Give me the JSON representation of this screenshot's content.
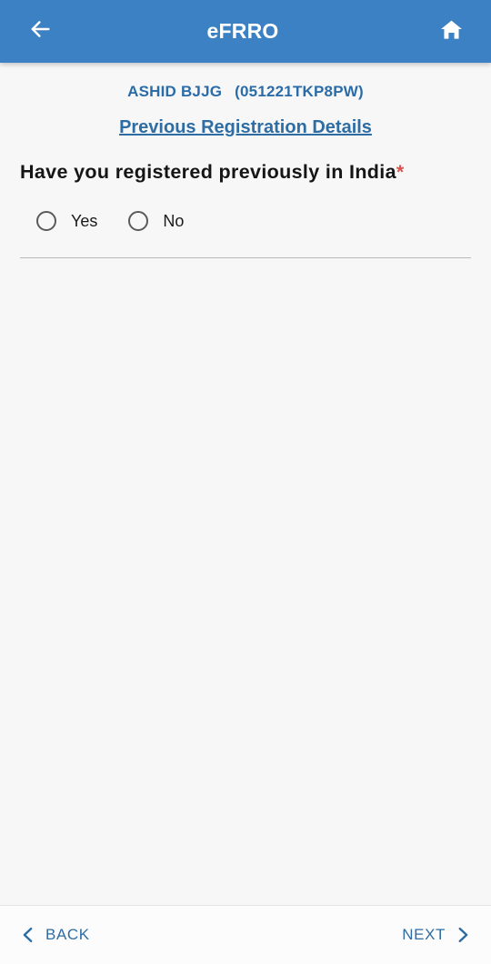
{
  "appbar": {
    "back_icon": "arrow-left-icon",
    "title": "eFRRO",
    "home_icon": "home-icon"
  },
  "applicant": {
    "name": "ASHID BJJG",
    "id": "(051221TKP8PW)"
  },
  "section": {
    "link_label": "Previous Registration Details"
  },
  "form": {
    "question_text": "Have you registered previously in India",
    "required_marker": "*",
    "options": [
      {
        "label": "Yes",
        "selected": false
      },
      {
        "label": "No",
        "selected": false
      }
    ]
  },
  "bottom_nav": {
    "back_label": "BACK",
    "back_icon": "chevron-left-icon",
    "next_label": "NEXT",
    "next_icon": "chevron-right-icon"
  },
  "colors": {
    "appbar_blue": "#3b81c3",
    "link_blue": "#2e6da4",
    "required_red": "#d9534f",
    "page_background": "#f7f7f8"
  }
}
